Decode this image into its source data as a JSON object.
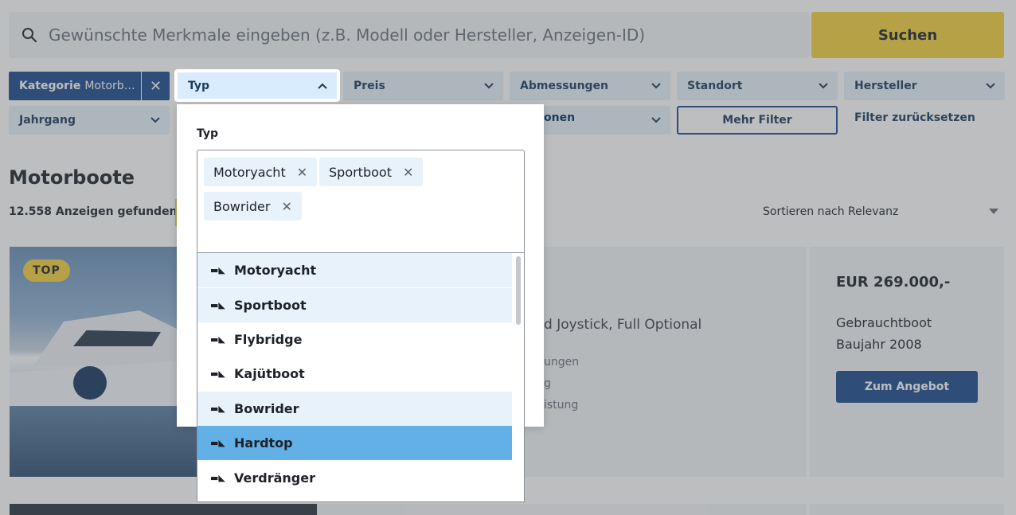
{
  "search": {
    "placeholder": "Gewünschte Merkmale eingeben (z.B. Modell oder Hersteller, Anzeigen-ID)",
    "button_label": "Suchen"
  },
  "filters": {
    "kategorie_label": "Kategorie",
    "kategorie_value": "Motorb…",
    "typ": "Typ",
    "preis": "Preis",
    "abmessungen": "Abmessungen",
    "standort": "Standort",
    "hersteller": "Hersteller",
    "jahrgang": "Jahrgang",
    "partial_hidden": "onen",
    "mehr_filter": "Mehr Filter",
    "reset": "Filter zurücksetzen"
  },
  "results": {
    "title": "Motorboote",
    "count": "12.558 Anzeigen gefunden",
    "sort": "Sortieren nach Relevanz"
  },
  "listing": {
    "badge": "TOP",
    "description_fragment": "d Joystick, Full Optional",
    "detail_fragment_1": "ungen",
    "detail_fragment_2": "g",
    "detail_fragment_3": "istung",
    "price": "EUR 269.000,-",
    "condition": "Gebrauchtboot",
    "year": "Baujahr 2008",
    "offer_button": "Zum Angebot"
  },
  "dropdown": {
    "label": "Typ",
    "selected_tags": [
      "Motoryacht",
      "Sportboot",
      "Bowrider"
    ],
    "options": [
      {
        "label": "Motoryacht",
        "state": "selected",
        "icon": "motoryacht-icon"
      },
      {
        "label": "Sportboot",
        "state": "selected",
        "icon": "sportboot-icon"
      },
      {
        "label": "Flybridge",
        "state": "normal",
        "icon": "flybridge-icon"
      },
      {
        "label": "Kajütboot",
        "state": "normal",
        "icon": "kajuetboot-icon"
      },
      {
        "label": "Bowrider",
        "state": "selected",
        "icon": "bowrider-icon"
      },
      {
        "label": "Hardtop",
        "state": "hover",
        "icon": "hardtop-icon"
      },
      {
        "label": "Verdränger",
        "state": "normal",
        "icon": "verdraenger-icon"
      }
    ]
  },
  "colors": {
    "accent_yellow": "#f6d13c",
    "primary_blue": "#1a4a8c",
    "chip_bg": "#e8f2fb",
    "hover_blue": "#63b0e6"
  }
}
